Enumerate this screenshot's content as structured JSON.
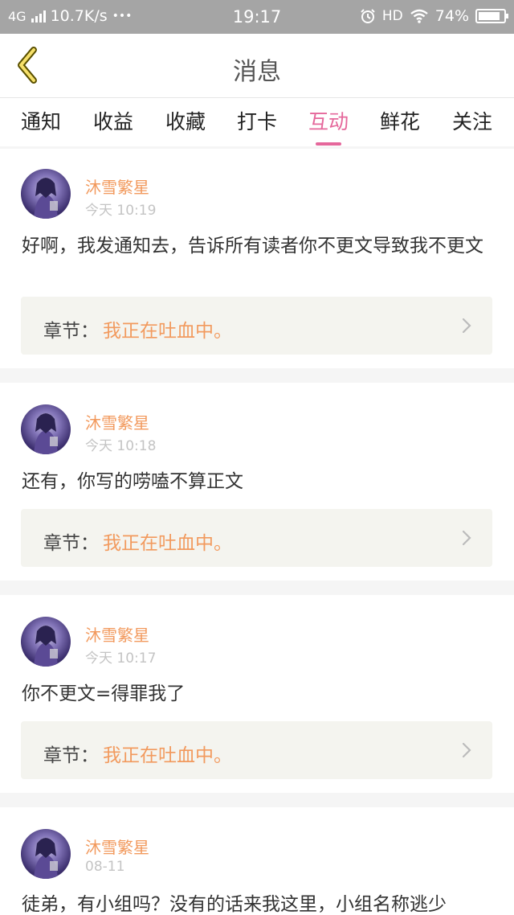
{
  "status_bar": {
    "network": "4G",
    "speed": "10.7K/s",
    "more": "•••",
    "time": "19:17",
    "hd": "HD",
    "battery": "74%"
  },
  "header": {
    "title": "消息",
    "back_icon": "chevron-left-icon"
  },
  "tabs": [
    {
      "label": "通知",
      "active": false
    },
    {
      "label": "收益",
      "active": false
    },
    {
      "label": "收藏",
      "active": false
    },
    {
      "label": "打卡",
      "active": false
    },
    {
      "label": "互动",
      "active": true
    },
    {
      "label": "鲜花",
      "active": false
    },
    {
      "label": "关注",
      "active": false
    }
  ],
  "messages": [
    {
      "user": "沐雪繁星",
      "time": "今天 10:19",
      "text": "好啊，我发通知去，告诉所有读者你不更文导致我不更文",
      "chapter_label": "章节：",
      "chapter_title": "我正在吐血中。"
    },
    {
      "user": "沐雪繁星",
      "time": "今天 10:18",
      "text": "还有，你写的唠嗑不算正文",
      "chapter_label": "章节：",
      "chapter_title": "我正在吐血中。"
    },
    {
      "user": "沐雪繁星",
      "time": "今天 10:17",
      "text": "你不更文=得罪我了",
      "chapter_label": "章节：",
      "chapter_title": "我正在吐血中。"
    },
    {
      "user": "沐雪繁星",
      "time": "08-11",
      "text": "徒弟，有小组吗？没有的话来我这里，小组名称逃少"
    }
  ],
  "colors": {
    "accent": "#e5679b",
    "username": "#f29a5e",
    "status_bar": "#a5a5a5"
  }
}
